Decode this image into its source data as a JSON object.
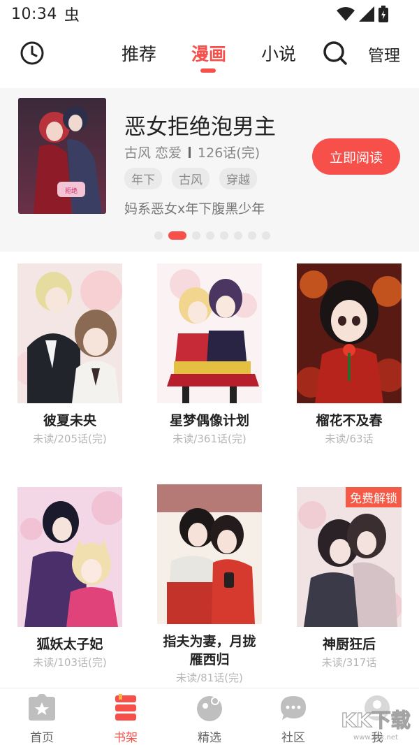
{
  "status": {
    "time": "10:34",
    "bug_glyph": "虫"
  },
  "nav": {
    "tabs": [
      {
        "label": "推荐"
      },
      {
        "label": "漫画"
      },
      {
        "label": "小说"
      }
    ],
    "manage_label": "管理",
    "accent": "#f7504a"
  },
  "banner": {
    "title": "恶女拒绝泡男主",
    "genres": "古风 恋爱",
    "chapters": "126话(完)",
    "tags": [
      "年下",
      "古风",
      "穿越"
    ],
    "description": "妈系恶女x年下腹黑少年",
    "read_button": "立即阅读",
    "page_count": 8,
    "active_page": 1
  },
  "books": [
    {
      "title": "彼夏未央",
      "sub": "未读/205话(完)"
    },
    {
      "title": "星梦偶像计划",
      "sub": "未读/361话(完)"
    },
    {
      "title": "榴花不及春",
      "sub": "未读/63话"
    },
    {
      "title": "狐妖太子妃",
      "sub": "未读/103话(完)"
    },
    {
      "title": "指夫为妻，月拢雁西归",
      "sub": "未读/81话(完)"
    },
    {
      "title": "神厨狂后",
      "sub": "未读/317话",
      "badge": "免费解锁"
    }
  ],
  "bottom_nav": [
    {
      "label": "首页",
      "icon": "home-star-icon"
    },
    {
      "label": "书架",
      "icon": "bookshelf-icon"
    },
    {
      "label": "精选",
      "icon": "featured-icon"
    },
    {
      "label": "社区",
      "icon": "chat-bubble-icon"
    },
    {
      "label": "我",
      "icon": "profile-icon"
    }
  ],
  "watermark": "KK下载"
}
